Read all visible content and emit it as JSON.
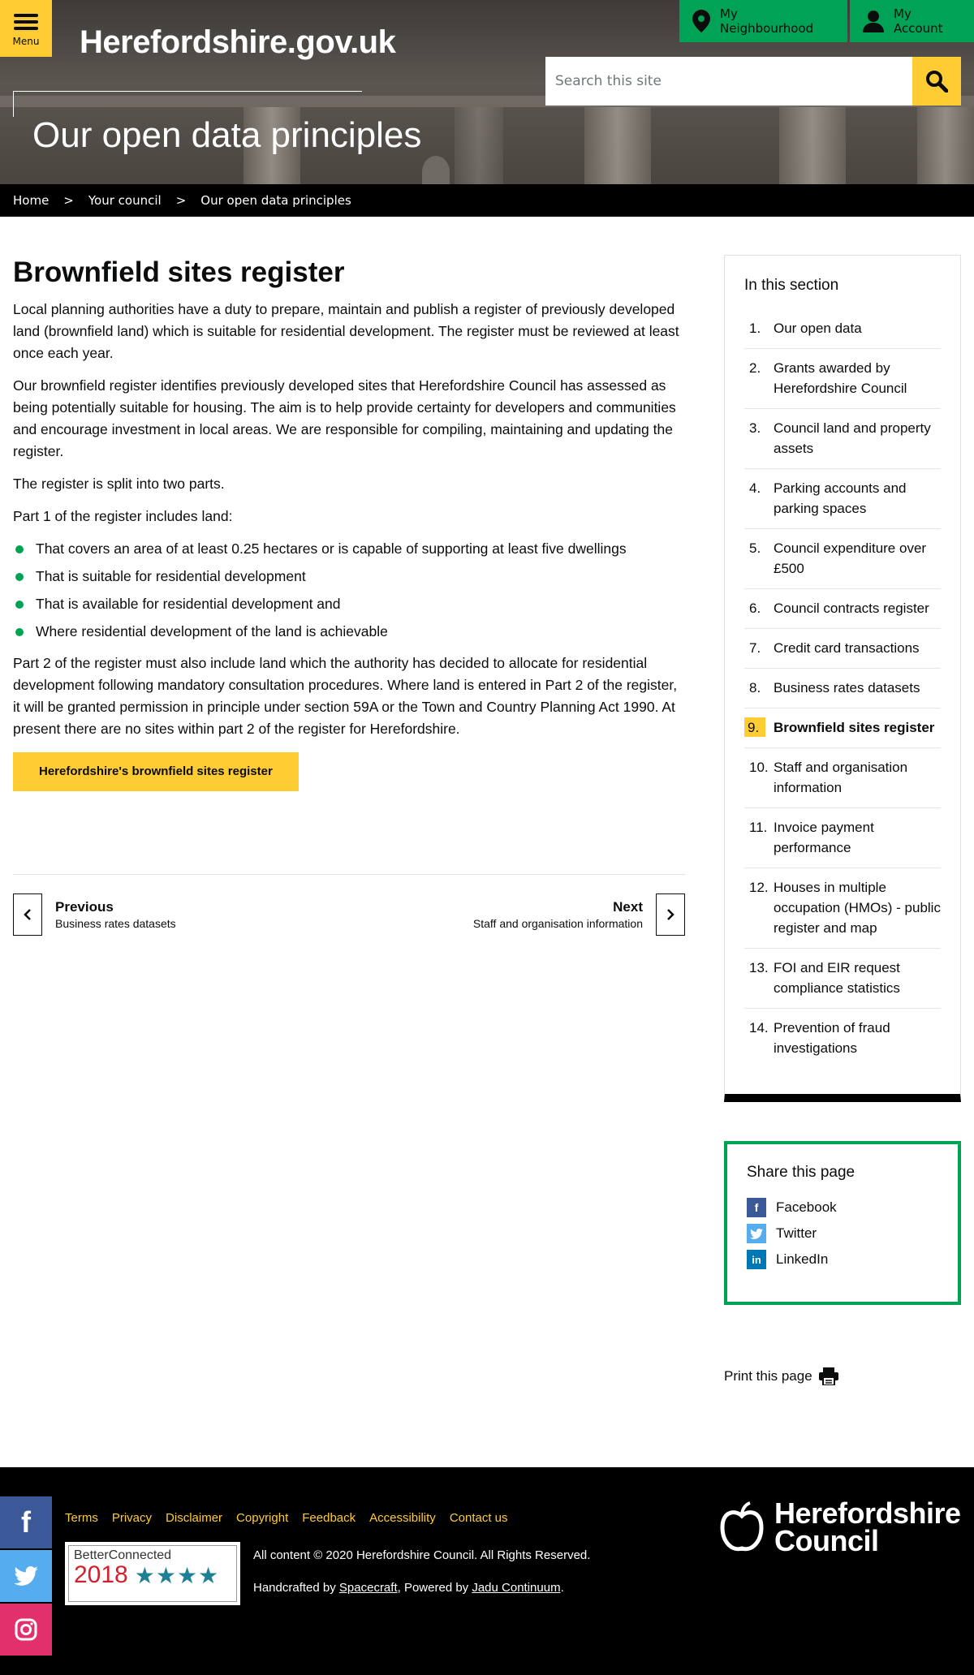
{
  "header": {
    "menu_label": "Menu",
    "logo_text": "Herefordshire.gov.uk",
    "page_title": "Our open data principles",
    "top_links": {
      "neighbourhood": "My Neighbourhood",
      "account": "My Account"
    },
    "search": {
      "placeholder": "Search this site"
    },
    "colors": {
      "accent": "#ffcc33",
      "green": "#00a355"
    }
  },
  "breadcrumb": [
    "Home",
    "Your council",
    "Our open data principles"
  ],
  "main": {
    "heading": "Brownfield sites register",
    "paragraphs": [
      "Local planning authorities have a duty to prepare, maintain and publish a register of previously developed land (brownfield land) which is suitable for residential development. The register must be reviewed at least once each year.",
      "Our brownfield register identifies previously developed sites that Herefordshire Council has assessed as being potentially suitable for housing. The aim is to help provide certainty for developers and communities and encourage investment in local areas. We are responsible for compiling, maintaining and updating the register.",
      "The register is split into two parts.",
      "Part 1 of the register includes land:"
    ],
    "bullets": [
      "That covers an area of at least 0.25 hectares or is capable of supporting at least five dwellings",
      "That is suitable for residential development",
      "That is available for residential development and",
      "Where residential development of the land is achievable"
    ],
    "part2": "Part 2 of the register must also include land which the authority has decided to allocate for residential development following mandatory consultation procedures. Where land is entered in Part 2 of the register, it will be granted permission in principle under section 59A or the Town and Country Planning Act 1990. At present there are no sites within part 2 of the register for Herefordshire.",
    "cta": "Herefordshire's brownfield sites register"
  },
  "pager": {
    "prev_label": "Previous",
    "prev_title": "Business rates datasets",
    "next_label": "Next",
    "next_title": "Staff and organisation information"
  },
  "section_nav": {
    "heading": "In this section",
    "items": [
      {
        "num": "1.",
        "label": "Our open data"
      },
      {
        "num": "2.",
        "label": "Grants awarded by Herefordshire Council"
      },
      {
        "num": "3.",
        "label": "Council land and property assets"
      },
      {
        "num": "4.",
        "label": "Parking accounts and parking spaces"
      },
      {
        "num": "5.",
        "label": "Council expenditure over £500"
      },
      {
        "num": "6.",
        "label": "Council contracts register"
      },
      {
        "num": "7.",
        "label": "Credit card transactions"
      },
      {
        "num": "8.",
        "label": "Business rates datasets"
      },
      {
        "num": "9.",
        "label": "Brownfield sites register",
        "active": true
      },
      {
        "num": "10.",
        "label": "Staff and organisation information"
      },
      {
        "num": "11.",
        "label": "Invoice payment performance"
      },
      {
        "num": "12.",
        "label": "Houses in multiple occupation (HMOs) - public register and map"
      },
      {
        "num": "13.",
        "label": "FOI and EIR request compliance statistics"
      },
      {
        "num": "14.",
        "label": "Prevention of fraud investigations"
      }
    ]
  },
  "share": {
    "heading": "Share this page",
    "facebook": "Facebook",
    "twitter": "Twitter",
    "linkedin": "LinkedIn"
  },
  "print_label": "Print this page",
  "footer": {
    "links": [
      "Terms",
      "Privacy",
      "Disclaimer",
      "Copyright",
      "Feedback",
      "Accessibility",
      "Contact us"
    ],
    "badge_title": "BetterConnected",
    "badge_year": "2018",
    "badge_stars": "★★★★",
    "copyright": "All content © 2020 Herefordshire Council. All Rights Reserved.",
    "credits_prefix": "Handcrafted by ",
    "credits_spacecraft": "Spacecraft",
    "credits_mid": ", Powered by ",
    "credits_jadu": "Jadu Continuum",
    "credits_suffix": ".",
    "council_name_1": "Herefordshire",
    "council_name_2": "Council"
  }
}
